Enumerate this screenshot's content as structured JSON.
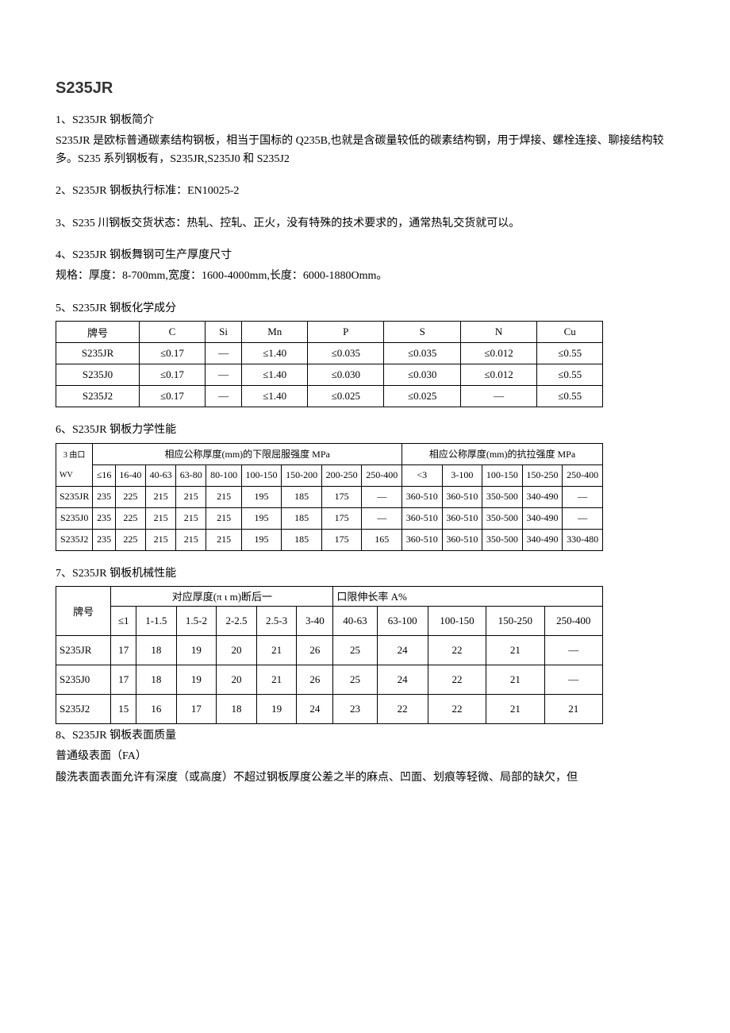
{
  "title": "S235JR",
  "s1": {
    "label": "1、S235JR 钢板简介",
    "p1": "S235JR 是欧标普通碳素结构钢板，相当于国标的 Q235B,也就是含碳量较低的碳素结构钢，用于焊接、螺栓连接、聊接结构较多。S235 系列钢板有，S235JR,S235J0 和 S235J2"
  },
  "s2": {
    "label": "2、S235JR 钢板执行标准：EN10025-2"
  },
  "s3": {
    "label": "3、S235 川钢板交货状态：热轧、控轧、正火，没有特殊的技术要求的，通常热轧交货就可以。"
  },
  "s4": {
    "label": "4、S235JR 钢板舞钢可生产厚度尺寸",
    "p1": "规格：厚度：8-700mm,宽度：1600-4000mm,长度：6000-1880Omm。"
  },
  "s5": {
    "label": "5、S235JR 钢板化学成分",
    "headers": [
      "牌号",
      "C",
      "Si",
      "Mn",
      "P",
      "S",
      "N",
      "Cu"
    ],
    "rows": [
      [
        "S235JR",
        "≤0.17",
        "—",
        "≤1.40",
        "≤0.035",
        "≤0.035",
        "≤0.012",
        "≤0.55"
      ],
      [
        "S235J0",
        "≤0.17",
        "—",
        "≤1.40",
        "≤0.030",
        "≤0.030",
        "≤0.012",
        "≤0.55"
      ],
      [
        "S235J2",
        "≤0.17",
        "—",
        "≤1.40",
        "≤0.025",
        "≤0.025",
        "—",
        "≤0.55"
      ]
    ]
  },
  "s6": {
    "label": "6、S235JR 钢板力学性能",
    "hdr_left": "相应公称厚度(mm)的下限屈服强度 MPa",
    "hdr_right": "相应公称厚度(mm)的抗拉强度 MPa",
    "corner1": "3 由口",
    "corner2": "WV",
    "yield_cols": [
      "≤16",
      "16-40",
      "40-63",
      "63-80",
      "80-100",
      "100-150",
      "150-200",
      "200-250",
      "250-400"
    ],
    "tens_cols": [
      "<3",
      "3-100",
      "100-150",
      "150-250",
      "250-400"
    ],
    "rows": [
      {
        "g": "S235JR",
        "y": [
          "235",
          "225",
          "215",
          "215",
          "215",
          "195",
          "185",
          "175",
          "—"
        ],
        "t": [
          "360-510",
          "360-510",
          "350-500",
          "340-490",
          "—"
        ]
      },
      {
        "g": "S235J0",
        "y": [
          "235",
          "225",
          "215",
          "215",
          "215",
          "195",
          "185",
          "175",
          "—"
        ],
        "t": [
          "360-510",
          "360-510",
          "350-500",
          "340-490",
          "—"
        ]
      },
      {
        "g": "S235J2",
        "y": [
          "235",
          "225",
          "215",
          "215",
          "215",
          "195",
          "185",
          "175",
          "165"
        ],
        "t": [
          "360-510",
          "360-510",
          "350-500",
          "340-490",
          "330-480"
        ]
      }
    ]
  },
  "s7": {
    "label": "7、S235JR 钢板机械性能",
    "hdr_left": "对应厚度(π ι m)断后一",
    "hdr_right": "口限伸长率 A%",
    "rowhdr": "牌号",
    "cols": [
      "≤1",
      "1-1.5",
      "1.5-2",
      "2-2.5",
      "2.5-3",
      "3-40",
      "40-63",
      "63-100",
      "100-150",
      "150-250",
      "250-400"
    ],
    "rows": [
      [
        "S235JR",
        "17",
        "18",
        "19",
        "20",
        "21",
        "26",
        "25",
        "24",
        "22",
        "21",
        "—"
      ],
      [
        "S235J0",
        "17",
        "18",
        "19",
        "20",
        "21",
        "26",
        "25",
        "24",
        "22",
        "21",
        "—"
      ],
      [
        "S235J2",
        "15",
        "16",
        "17",
        "18",
        "19",
        "24",
        "23",
        "22",
        "22",
        "21",
        "21"
      ]
    ]
  },
  "s8": {
    "label": "8、S235JR 钢板表面质量",
    "p1": "普通级表面（FA）",
    "p2": "酸洗表面表面允许有深度（或高度）不超过钢板厚度公差之半的麻点、凹面、划痕等轻微、局部的缺欠，但"
  }
}
